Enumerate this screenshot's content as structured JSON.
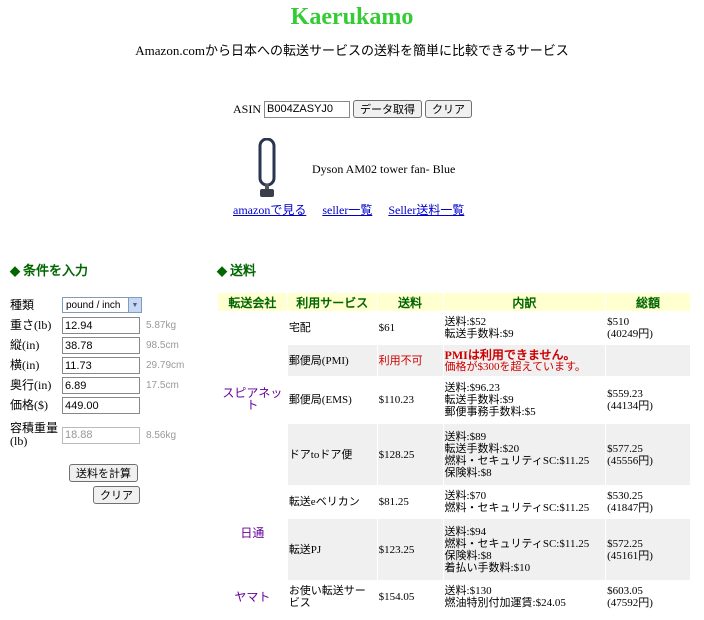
{
  "header": {
    "title": "Kaerukamo",
    "subtitle": "Amazon.comから日本への転送サービスの送料を簡単に比較できるサービス"
  },
  "asin": {
    "label": "ASIN",
    "value": "B004ZASYJ0",
    "fetch_button": "データ取得",
    "clear_button": "クリア"
  },
  "product": {
    "name": "Dyson AM02 tower fan- Blue",
    "links": [
      "amazonで見る",
      "seller一覧",
      "Seller送料一覧"
    ]
  },
  "conditions": {
    "heading": "条件を入力",
    "type_label": "種類",
    "type_value": "pound / inch",
    "weight_label": "重さ(lb)",
    "weight_value": "12.94",
    "weight_unit": "5.87kg",
    "length_label": "縦(in)",
    "length_value": "38.78",
    "length_unit": "98.5cm",
    "width_label": "横(in)",
    "width_value": "11.73",
    "width_unit": "29.79cm",
    "depth_label": "奥行(in)",
    "depth_value": "6.89",
    "depth_unit": "17.5cm",
    "price_label": "価格($)",
    "price_value": "449.00",
    "volweight_label": "容積重量(lb)",
    "volweight_value": "18.88",
    "volweight_unit": "8.56kg",
    "calc_button": "送料を計算",
    "clear_button": "クリア"
  },
  "shipping": {
    "heading": "送料",
    "columns": [
      "転送会社",
      "利用サービス",
      "送料",
      "内訳",
      "総額"
    ],
    "rows": [
      {
        "carrier": "スピアネット",
        "service": "宅配",
        "price": "$61",
        "detail": [
          "送料:$52",
          "転送手数料:$9"
        ],
        "total": [
          "$510",
          "(40249円)"
        ]
      },
      {
        "service": "郵便局(PMI)",
        "price": "利用不可",
        "detail": [
          "PMIは利用できません。",
          "価格が$300を超えています。"
        ],
        "total": []
      },
      {
        "service": "郵便局(EMS)",
        "price": "$110.23",
        "detail": [
          "送料:$96.23",
          "転送手数料:$9",
          "郵便事務手数料:$5"
        ],
        "total": [
          "$559.23",
          "(44134円)"
        ]
      },
      {
        "service": "ドアtoドア便",
        "price": "$128.25",
        "detail": [
          "送料:$89",
          "転送手数料:$20",
          "燃料・セキュリティSC:$11.25",
          "保険料:$8"
        ],
        "total": [
          "$577.25",
          "(45556円)"
        ]
      },
      {
        "carrier": "日通",
        "service": "転送eベリカン",
        "price": "$81.25",
        "detail": [
          "送料:$70",
          "燃料・セキュリティSC:$11.25"
        ],
        "total": [
          "$530.25",
          "(41847円)"
        ]
      },
      {
        "service": "転送PJ",
        "price": "$123.25",
        "detail": [
          "送料:$94",
          "燃料・セキュリティSC:$11.25",
          "保険料:$8",
          "着払い手数料:$10"
        ],
        "total": [
          "$572.25",
          "(45161円)"
        ]
      },
      {
        "carrier": "ヤマト",
        "service": "お使い転送サービス",
        "price": "$154.05",
        "detail": [
          "送料:$130",
          "燃油特別付加運賃:$24.05"
        ],
        "total": [
          "$603.05",
          "(47592円)"
        ]
      }
    ]
  }
}
